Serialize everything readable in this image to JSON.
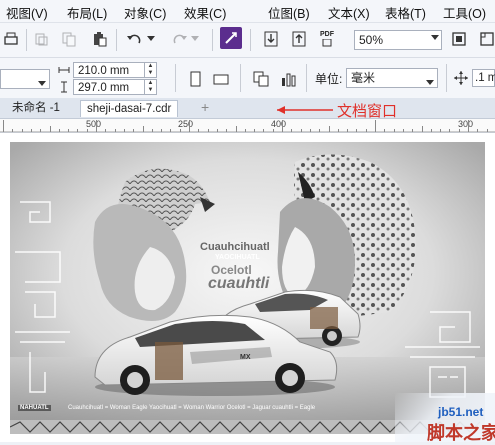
{
  "menu": {
    "items": [
      "视图(V)",
      "布局(L)",
      "对象(C)",
      "效果(C)",
      "位图(B)",
      "文本(X)",
      "表格(T)",
      "工具(O)"
    ]
  },
  "toolbar": {
    "zoom_value": "50%",
    "pdf_label": "PDF"
  },
  "property_bar": {
    "width_value": "210.0 mm",
    "height_value": "297.0 mm",
    "unit_label": "单位:",
    "unit_value": "毫米",
    "nudge_value": ".1 m"
  },
  "tabs": [
    {
      "label": "未命名 -1",
      "active": false
    },
    {
      "label": "sheji-dasai-7.cdr",
      "active": true
    }
  ],
  "tab_add_label": "+",
  "annotation": {
    "label": "文档窗口",
    "color": "#e0302a"
  },
  "ruler": {
    "labels": [
      "500",
      "250",
      "400",
      "300"
    ]
  },
  "artwork": {
    "title_line1": "Cuauhcihuatl",
    "title_line1_sub": "YAOCIHUATL",
    "title_line2": "Ocelotl",
    "title_line3": "cuauhtli",
    "plate": "MX",
    "footer_brand": "NAHUATL",
    "footer_text": "Cuauhcihuatl = Woman Eagle  Yaocihuatl = Woman Warrior  Ocelotl = Jaguar  cuauhtli = Eagle"
  },
  "watermark": {
    "site": "jb51.net",
    "name": "脚本之家"
  },
  "colors": {
    "accent_purple": "#5b2d8e",
    "active_tab_bg": "#ffffff"
  }
}
